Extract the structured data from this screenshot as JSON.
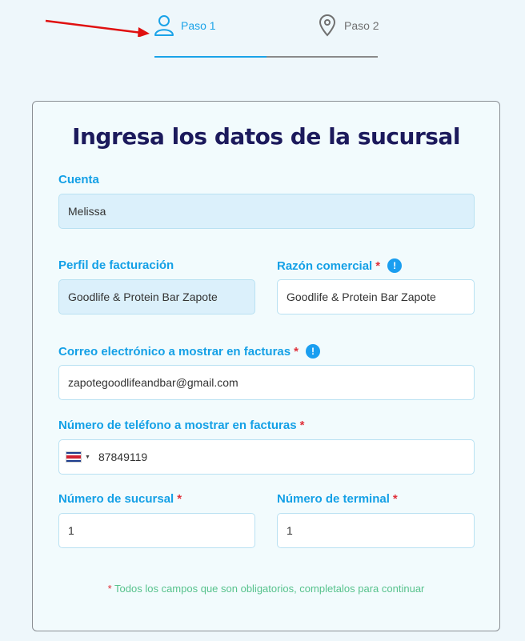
{
  "stepper": {
    "steps": [
      {
        "label": "Paso 1",
        "icon": "user-icon",
        "active": true
      },
      {
        "label": "Paso 2",
        "icon": "map-pin-icon",
        "active": false
      }
    ],
    "progress": 0.5
  },
  "form": {
    "title": "Ingresa los datos de la sucursal",
    "required_mark": "*",
    "info_mark": "!",
    "cuenta": {
      "label": "Cuenta",
      "value": "Melissa"
    },
    "perfil": {
      "label": "Perfil de facturación",
      "value": "Goodlife & Protein Bar Zapote"
    },
    "razon": {
      "label": "Razón comercial",
      "value": "Goodlife & Protein Bar Zapote"
    },
    "correo": {
      "label": "Correo electrónico a mostrar en facturas",
      "value": "zapotegoodlifeandbar@gmail.com"
    },
    "telefono": {
      "label": "Número de teléfono a mostrar en facturas",
      "value": "87849119",
      "country": "Costa Rica"
    },
    "sucursal": {
      "label": "Número de sucursal",
      "value": "1"
    },
    "terminal": {
      "label": "Número de terminal",
      "value": "1"
    },
    "footnote": "Todos los campos que son obligatorios, completalos para continuar"
  },
  "colors": {
    "accent": "#14a0e6",
    "title": "#1c1a5c",
    "required": "#e0303a",
    "footnote": "#56c28c",
    "annotation_arrow": "#e01010"
  }
}
